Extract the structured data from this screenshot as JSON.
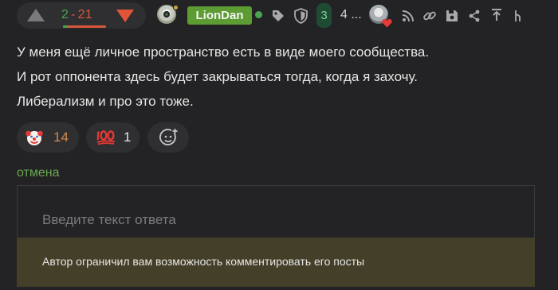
{
  "rating": {
    "plus": "2",
    "separator": "-",
    "minus": "21",
    "positive_share": 0.087
  },
  "author": {
    "name": "LionDan",
    "online": true
  },
  "header_icons": {
    "tag": "tag-icon",
    "shield": "shield-icon",
    "rss": "rss-icon",
    "link": "link-icon",
    "save": "save-icon",
    "share": "share-icon",
    "go_up": "arrow-up-icon",
    "branch": "branch-icon"
  },
  "thread": {
    "badge_count": "3",
    "extra_text": "4 ..."
  },
  "comment": {
    "lines": [
      "У меня ещё личное пространство есть в виде моего сообщества.",
      "И рот оппонента здесь будет закрываться тогда, когда я захочу.",
      "Либерализм и про это тоже."
    ]
  },
  "reactions": [
    {
      "emoji": "clown-face-icon",
      "count": "14"
    },
    {
      "emoji": "hundred-points-icon",
      "count": "1"
    }
  ],
  "reply": {
    "cancel_label": "отмена",
    "placeholder": "Введите текст ответа",
    "restriction_notice": "Автор ограничил вам возможность комментировать его посты"
  },
  "colors": {
    "background": "#232325",
    "pill": "#2f2f32",
    "plus": "#4aa54f",
    "minus": "#d8583a",
    "author_badge": "#5c9c33",
    "notice_bg": "#443f28",
    "link": "#6aa84f"
  }
}
